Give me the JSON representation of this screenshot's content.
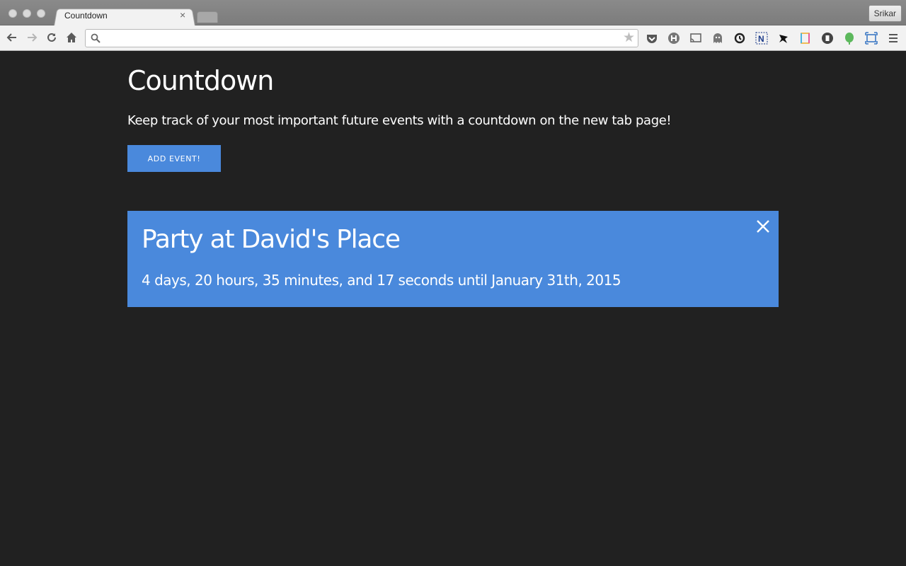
{
  "browser": {
    "tab_title": "Countdown",
    "tab_close": "×",
    "profile_name": "Srikar",
    "address_value": "",
    "extensions": [
      "pocket-icon",
      "honey-icon",
      "cast-icon",
      "ghostery-icon",
      "sync-icon",
      "newsmast-icon",
      "ninja-icon",
      "notebook-icon",
      "dashlane-icon",
      "evernote-icon",
      "capture-icon",
      "menu-icon"
    ]
  },
  "page": {
    "title": "Countdown",
    "subtitle": "Keep track of your most important future events with a countdown on the new tab page!",
    "add_button_label": "ADD EVENT!"
  },
  "events": [
    {
      "title": "Party at David's Place",
      "countdown": "4 days, 20 hours, 35 minutes, and 17 seconds until January 31th, 2015"
    }
  ],
  "colors": {
    "background": "#212121",
    "accent": "#4a89dc",
    "text": "#ffffff"
  }
}
